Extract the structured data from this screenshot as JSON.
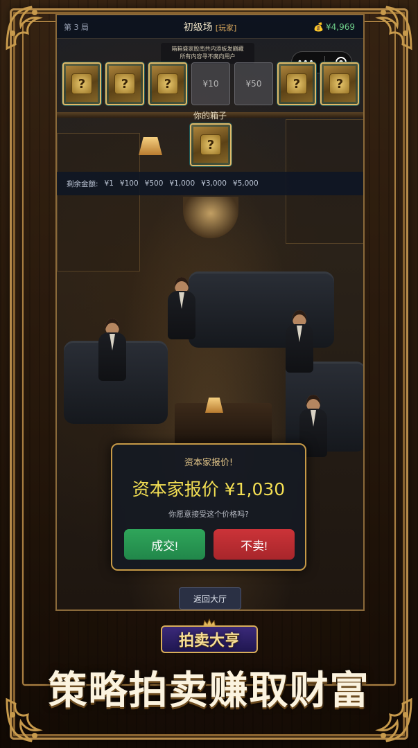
{
  "hud": {
    "round": "第 3 局",
    "level": "初级场",
    "role": "[玩家]",
    "money": "¥4,969"
  },
  "notice": {
    "line1": "箱箱盛家股南共内添板发巅藏",
    "line2": "所有内容寻不腐向用户"
  },
  "boxes": [
    {
      "type": "hidden",
      "symbol": "?"
    },
    {
      "type": "hidden",
      "symbol": "?"
    },
    {
      "type": "hidden",
      "symbol": "?"
    },
    {
      "type": "opened",
      "label": "¥10"
    },
    {
      "type": "opened",
      "label": "¥50"
    },
    {
      "type": "hidden",
      "symbol": "?"
    },
    {
      "type": "hidden",
      "symbol": "?"
    }
  ],
  "your_box": {
    "label": "你的箱子",
    "symbol": "?"
  },
  "remaining": {
    "label": "剩余金额:",
    "amounts": [
      "¥1",
      "¥100",
      "¥500",
      "¥1,000",
      "¥3,000",
      "¥5,000"
    ]
  },
  "dialog": {
    "title": "资本家报价!",
    "offer": "资本家报价 ¥1,030",
    "question": "你愿意接受这个价格吗?",
    "accept": "成交!",
    "decline": "不卖!"
  },
  "back_button": "返回大厅",
  "logo_text": "拍卖大亨",
  "slogan": "策略拍卖赚取财富",
  "colors": {
    "accept": "#2fa55a",
    "decline": "#cb3338",
    "offer": "#f3df53",
    "money": "#6fd08a",
    "frame_gold": "#b58a4a"
  }
}
